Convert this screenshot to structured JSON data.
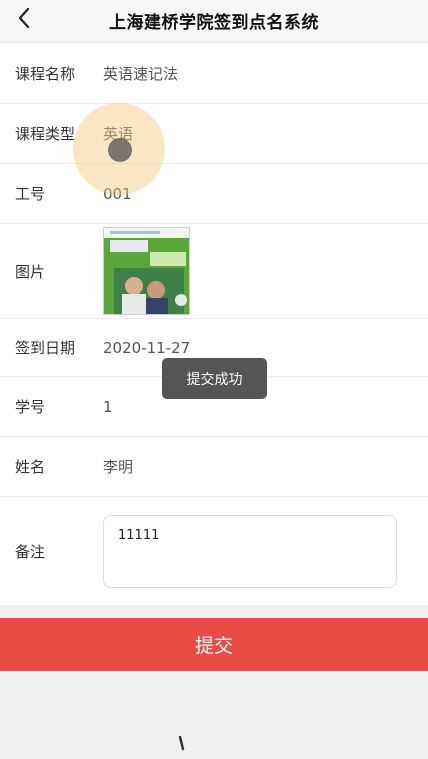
{
  "header": {
    "title": "上海建桥学院签到点名系统",
    "back_icon": "chevron-left-icon"
  },
  "form": {
    "course_name": {
      "label": "课程名称",
      "value": "英语速记法"
    },
    "course_type": {
      "label": "课程类型",
      "value": "英语"
    },
    "staff_id": {
      "label": "工号",
      "value": "001"
    },
    "picture": {
      "label": "图片"
    },
    "sign_date": {
      "label": "签到日期",
      "value": "2020-11-27"
    },
    "student_id": {
      "label": "学号",
      "value": "1"
    },
    "name": {
      "label": "姓名",
      "value": "李明"
    },
    "remark": {
      "label": "备注",
      "value": "11111"
    }
  },
  "toast": {
    "text": "提交成功"
  },
  "submit": {
    "label": "提交"
  },
  "colors": {
    "accent": "#e84c44",
    "toast_bg": "#555555",
    "touch_ring": "#f5c878"
  }
}
